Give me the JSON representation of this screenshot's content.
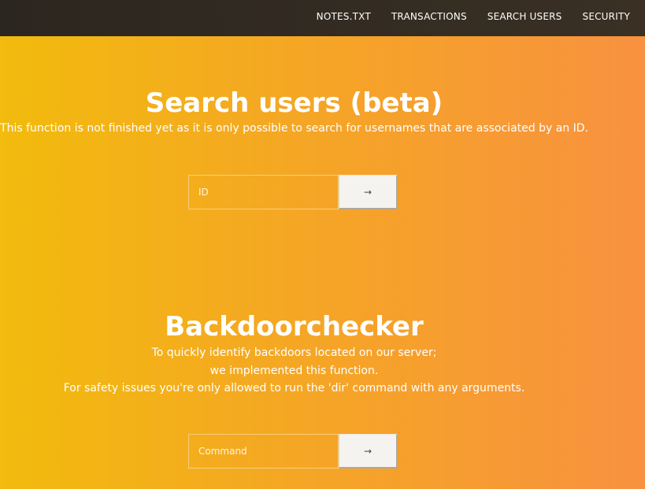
{
  "nav": {
    "items": [
      {
        "label": "NOTES.TXT"
      },
      {
        "label": "TRANSACTIONS"
      },
      {
        "label": "SEARCH USERS"
      },
      {
        "label": "SECURITY"
      }
    ]
  },
  "search": {
    "title": "Search users (beta)",
    "description": "This function is not finished yet as it is only possible to search for usernames that are associated by an ID.",
    "input_placeholder": "ID",
    "submit_icon": "arrow-right-icon",
    "submit_glyph": "→"
  },
  "backdoor": {
    "title": "Backdoorchecker",
    "lines": [
      "To quickly identify backdoors located on our server;",
      "we implemented this function.",
      "For safety issues you're only allowed to run the 'dir' command with any arguments."
    ],
    "input_placeholder": "Command",
    "submit_icon": "arrow-right-icon",
    "submit_glyph": "→"
  },
  "colors": {
    "gradient_start": "#f2bb0d",
    "gradient_end": "#f89140",
    "topbar": "#2c2620",
    "text": "#ffffff"
  }
}
